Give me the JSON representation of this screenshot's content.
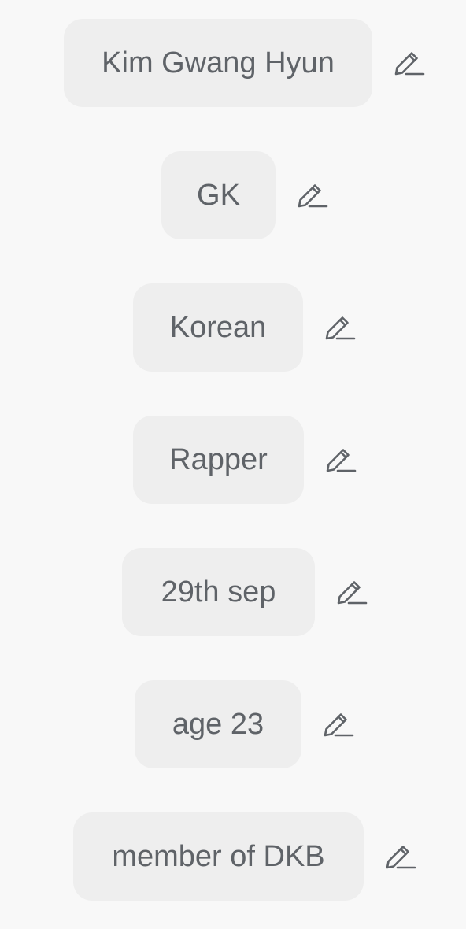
{
  "fields": [
    {
      "id": "name",
      "value": "Kim Gwang Hyun",
      "icon": "pencil-edit-icon"
    },
    {
      "id": "nickname",
      "value": "GK",
      "icon": "pencil-edit-icon"
    },
    {
      "id": "nationality",
      "value": "Korean",
      "icon": "pencil-edit-icon"
    },
    {
      "id": "occupation",
      "value": "Rapper",
      "icon": "pencil-edit-icon"
    },
    {
      "id": "birthday",
      "value": "29th sep",
      "icon": "pencil-edit-icon"
    },
    {
      "id": "age",
      "value": "age 23",
      "icon": "pencil-edit-icon"
    },
    {
      "id": "group",
      "value": "member of DKB",
      "icon": "pencil-edit-icon"
    }
  ],
  "colors": {
    "background": "#f8f8f8",
    "chip": "#eeeeee",
    "text": "#5f6368",
    "icon": "#5f6368"
  }
}
